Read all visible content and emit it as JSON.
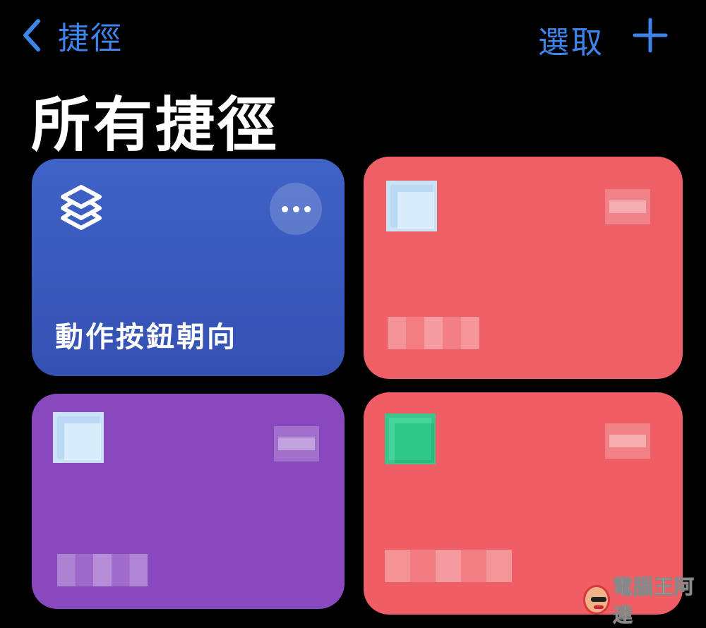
{
  "nav": {
    "back_label": "捷徑",
    "select_label": "選取"
  },
  "page": {
    "title": "所有捷徑"
  },
  "shortcuts": [
    {
      "label": "動作按鈕朝向",
      "color": "#3b5bc0",
      "icon": "shortcuts-stack-icon",
      "redacted": false
    },
    {
      "label": "",
      "color": "#ee5f66",
      "icon": "pixelated-app-icon",
      "redacted": true
    },
    {
      "label": "",
      "color": "#8848be",
      "icon": "pixelated-app-icon",
      "redacted": true
    },
    {
      "label": "",
      "color": "#ef5e65",
      "icon": "pixelated-app-icon",
      "redacted": true
    }
  ],
  "colors": {
    "accent": "#3d85ea",
    "background": "#000000"
  },
  "watermark": {
    "text": "電腦王阿達"
  }
}
